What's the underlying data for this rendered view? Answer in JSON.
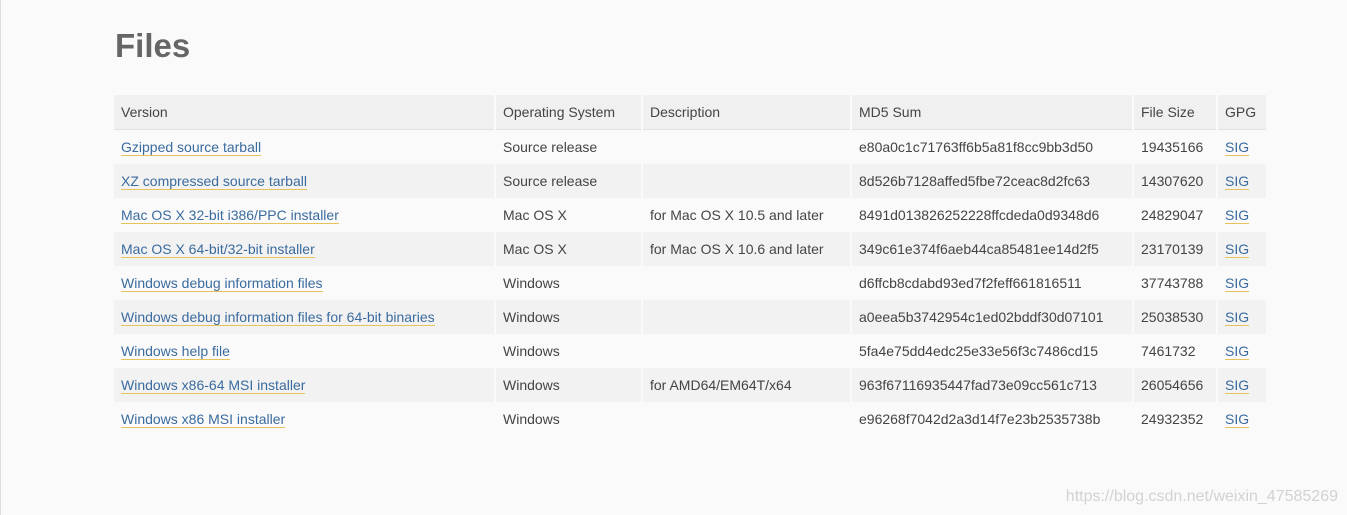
{
  "section_title": "Files",
  "table": {
    "headers": [
      "Version",
      "Operating System",
      "Description",
      "MD5 Sum",
      "File Size",
      "GPG"
    ],
    "rows": [
      {
        "version": "Gzipped source tarball",
        "os": "Source release",
        "description": "",
        "md5": "e80a0c1c71763ff6b5a81f8cc9bb3d50",
        "size": "19435166",
        "gpg": "SIG"
      },
      {
        "version": "XZ compressed source tarball",
        "os": "Source release",
        "description": "",
        "md5": "8d526b7128affed5fbe72ceac8d2fc63",
        "size": "14307620",
        "gpg": "SIG"
      },
      {
        "version": "Mac OS X 32-bit i386/PPC installer",
        "os": "Mac OS X",
        "description": "for Mac OS X 10.5 and later",
        "md5": "8491d013826252228ffcdeda0d9348d6",
        "size": "24829047",
        "gpg": "SIG"
      },
      {
        "version": "Mac OS X 64-bit/32-bit installer",
        "os": "Mac OS X",
        "description": "for Mac OS X 10.6 and later",
        "md5": "349c61e374f6aeb44ca85481ee14d2f5",
        "size": "23170139",
        "gpg": "SIG"
      },
      {
        "version": "Windows debug information files",
        "os": "Windows",
        "description": "",
        "md5": "d6ffcb8cdabd93ed7f2feff661816511",
        "size": "37743788",
        "gpg": "SIG"
      },
      {
        "version": "Windows debug information files for 64-bit binaries",
        "os": "Windows",
        "description": "",
        "md5": "a0eea5b3742954c1ed02bddf30d07101",
        "size": "25038530",
        "gpg": "SIG"
      },
      {
        "version": "Windows help file",
        "os": "Windows",
        "description": "",
        "md5": "5fa4e75dd4edc25e33e56f3c7486cd15",
        "size": "7461732",
        "gpg": "SIG"
      },
      {
        "version": "Windows x86-64 MSI installer",
        "os": "Windows",
        "description": "for AMD64/EM64T/x64",
        "md5": "963f67116935447fad73e09cc561c713",
        "size": "26054656",
        "gpg": "SIG"
      },
      {
        "version": "Windows x86 MSI installer",
        "os": "Windows",
        "description": "",
        "md5": "e96268f7042d2a3d14f7e23b2535738b",
        "size": "24932352",
        "gpg": "SIG"
      }
    ]
  },
  "watermark": "https://blog.csdn.net/weixin_47585269"
}
